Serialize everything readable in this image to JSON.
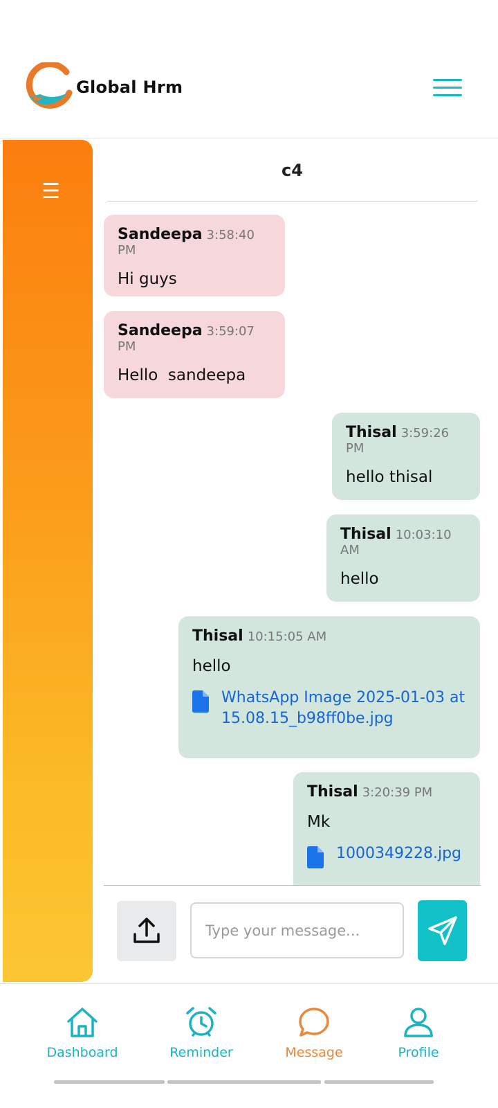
{
  "header": {
    "brand": "Global Hrm",
    "menu_icon": "hamburger-icon",
    "accent_color": "#1bb8c4"
  },
  "sidebar": {
    "toggle_glyph": "☰",
    "gradient_top": "#fb7e0e",
    "gradient_bottom": "#fcc633"
  },
  "chat": {
    "title": "c4",
    "messages": [
      {
        "sender": "Sandeepa",
        "time": "3:58:40 PM",
        "text": "Hi guys"
      },
      {
        "sender": "Sandeepa",
        "time": "3:59:07 PM",
        "text": "Hello  sandeepa"
      },
      {
        "sender": "Thisal",
        "time": "3:59:26 PM",
        "text": "hello thisal"
      },
      {
        "sender": "Thisal",
        "time": "10:03:10 AM",
        "text": "hello"
      },
      {
        "sender": "Thisal",
        "time": "10:15:05 AM",
        "text": "hello",
        "attachment": "WhatsApp Image 2025-01-03 at 15.08.15_b98ff0be.jpg"
      },
      {
        "sender": "Thisal",
        "time": "3:20:39 PM",
        "text": "Mk",
        "attachment": "1000349228.jpg"
      }
    ],
    "incoming_color": "#f6d7db",
    "outgoing_color": "#d2e6de"
  },
  "composer": {
    "upload_icon": "upload-icon",
    "placeholder": "Type your message...",
    "send_icon": "send-icon",
    "send_color": "#12c0c8"
  },
  "bottom_nav": {
    "items": [
      {
        "label": "Dashboard",
        "icon": "home-icon"
      },
      {
        "label": "Reminder",
        "icon": "alarm-clock-icon"
      },
      {
        "label": "Message",
        "icon": "chat-bubble-icon",
        "active": true
      },
      {
        "label": "Profile",
        "icon": "user-icon"
      }
    ],
    "active_color": "#e9873d",
    "inactive_color": "#1bb2c2"
  }
}
